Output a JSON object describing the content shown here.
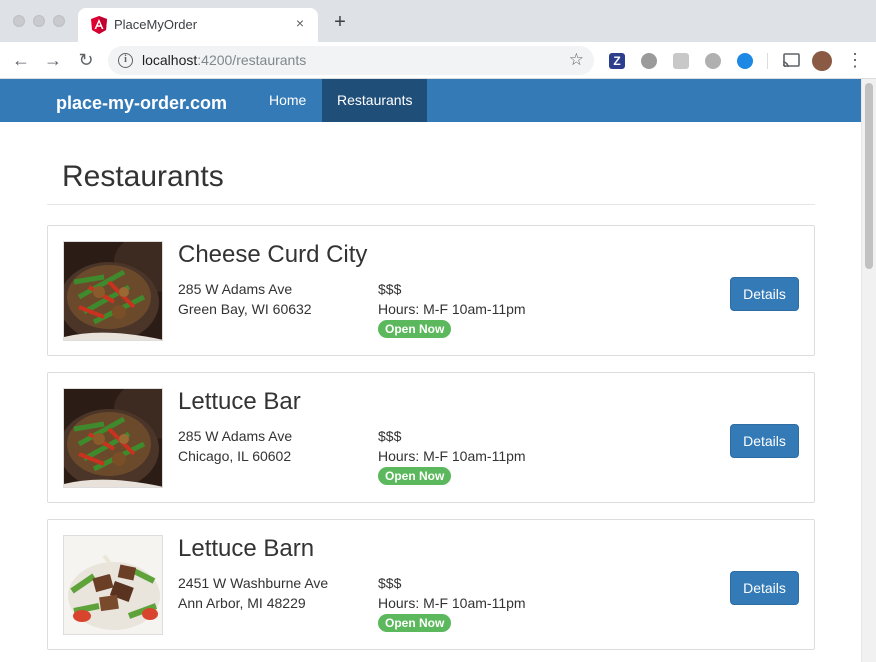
{
  "browser": {
    "tab_title": "PlaceMyOrder",
    "close_glyph": "×",
    "newtab_glyph": "+",
    "url_host": "localhost",
    "url_rest": ":4200/restaurants",
    "info_glyph": "i",
    "star_glyph": "☆",
    "back_glyph": "←",
    "forward_glyph": "→",
    "reload_glyph": "↻",
    "menu_glyph": "⋮",
    "extension_icons": [
      "z-extension-icon",
      "circle-extension-icon",
      "rss-extension-icon",
      "cookie-extension-icon",
      "video-extension-icon",
      "cast-icon",
      "profile-avatar"
    ]
  },
  "app": {
    "brand": "place-my-order.com",
    "nav": [
      {
        "label": "Home",
        "active": false
      },
      {
        "label": "Restaurants",
        "active": true
      }
    ],
    "page_title": "Restaurants",
    "restaurants": [
      {
        "name": "Cheese Curd City",
        "street": "285 W Adams Ave",
        "city": "Green Bay, WI 60632",
        "price": "$$$",
        "hours": "Hours: M-F 10am-11pm",
        "status": "Open Now",
        "button": "Details",
        "image": "stir-fry-dish"
      },
      {
        "name": "Lettuce Bar",
        "street": "285 W Adams Ave",
        "city": "Chicago, IL 60602",
        "price": "$$$",
        "hours": "Hours: M-F 10am-11pm",
        "status": "Open Now",
        "button": "Details",
        "image": "stir-fry-dish"
      },
      {
        "name": "Lettuce Barn",
        "street": "2451 W Washburne Ave",
        "city": "Ann Arbor, MI 48229",
        "price": "$$$",
        "hours": "Hours: M-F 10am-11pm",
        "status": "Open Now",
        "button": "Details",
        "image": "steak-salad"
      }
    ]
  },
  "colors": {
    "nav_bg": "#337ab7",
    "nav_active_bg": "#1f4e79",
    "badge_green": "#5cb85c",
    "button_blue": "#337ab7"
  }
}
